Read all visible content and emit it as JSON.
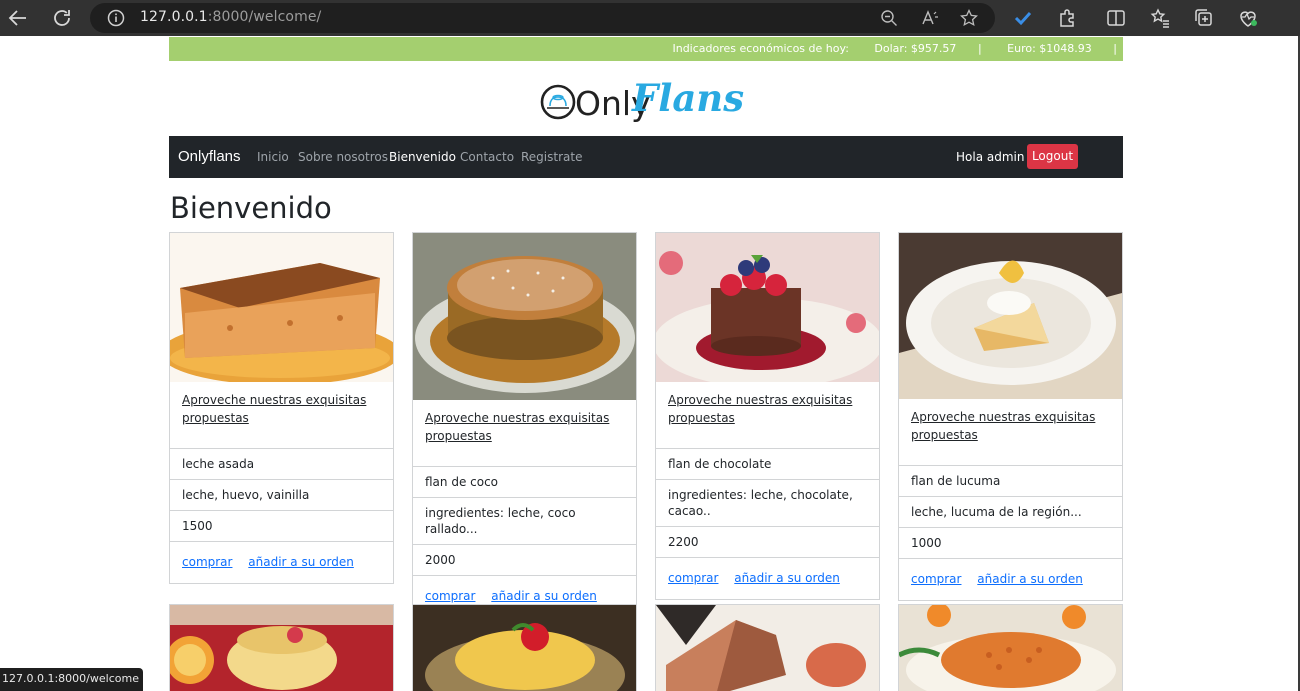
{
  "browser": {
    "url_host": "127.0.0.1",
    "url_rest": ":8000/welcome/"
  },
  "econ": {
    "label": "Indicadores económicos de hoy:",
    "dolar": "Dolar: $957.57",
    "euro": "Euro: $1048.93",
    "separator": "|"
  },
  "logo": {
    "text_only": "Only",
    "text_flans": "Flans"
  },
  "navbar": {
    "brand": "Onlyflans",
    "links": [
      "Inicio",
      "Sobre nosotros",
      "Bienvenido",
      "Contacto",
      "Registrate"
    ],
    "greeting": "Hola admin",
    "logout": "Logout"
  },
  "heading": "Bienvenido",
  "cards": [
    {
      "title": "Aproveche nuestras exquisitas propuestas",
      "name": "leche asada",
      "desc": "leche, huevo, vainilla",
      "price": "1500",
      "buy": "comprar",
      "add": "añadir a su orden"
    },
    {
      "title": "Aproveche nuestras exquisitas propuestas",
      "name": "flan de coco",
      "desc": "ingredientes: leche, coco rallado...",
      "price": "2000",
      "buy": "comprar",
      "add": "añadir a su orden"
    },
    {
      "title": "Aproveche nuestras exquisitas propuestas",
      "name": "flan de chocolate",
      "desc": "ingredientes: leche, chocolate, cacao..",
      "price": "2200",
      "buy": "comprar",
      "add": "añadir a su orden"
    },
    {
      "title": "Aproveche nuestras exquisitas propuestas",
      "name": "flan de lucuma",
      "desc": "leche, lucuma de la región...",
      "price": "1000",
      "buy": "comprar",
      "add": "añadir a su orden"
    }
  ],
  "status_url": "127.0.0.1:8000/welcome",
  "colors": {
    "econ_bar": "#a4cf6f",
    "navbar": "#212529",
    "logout": "#dc3545",
    "link": "#0d6efd",
    "logo_blue": "#29a9e1"
  }
}
